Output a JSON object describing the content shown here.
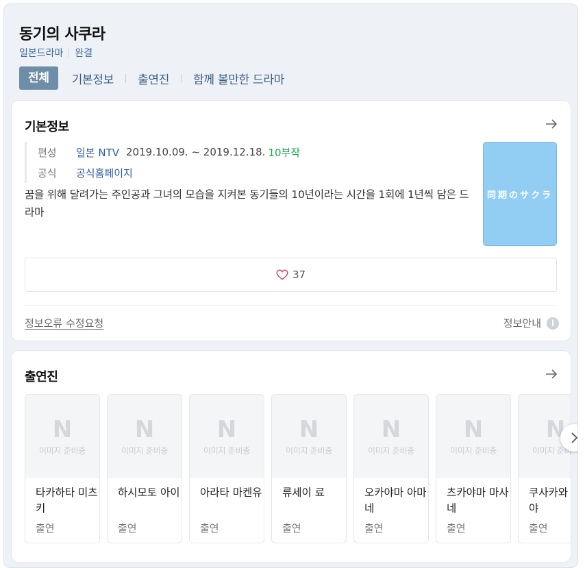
{
  "header": {
    "title": "동기의 사쿠라",
    "meta": [
      "일본드라마",
      "완결"
    ],
    "tabs": [
      {
        "label": "전체",
        "active": true
      },
      {
        "label": "기본정보",
        "active": false
      },
      {
        "label": "출연진",
        "active": false
      },
      {
        "label": "함께 볼만한 드라마",
        "active": false
      }
    ]
  },
  "basic_info": {
    "title": "기본정보",
    "broadcast_label": "편성",
    "broadcast_value": "일본 NTV",
    "broadcast_dates": "2019.10.09. ~ 2019.12.18.",
    "episodes": "10부작",
    "official_label": "공식",
    "official_value": "공식홈페이지",
    "description": "꿈을 위해 달려가는 주인공과 그녀의 모습을 지켜본 동기들의 10년이라는 시간을 1회에 1년씩 담은 드라마",
    "poster_text": "同期のサクラ",
    "likes": "37",
    "report_link": "정보오류 수정요청",
    "info_link": "정보안내",
    "info_icon": "i"
  },
  "cast": {
    "title": "출연진",
    "placeholder_logo": "N",
    "placeholder_text": "이미지 준비중",
    "members": [
      {
        "name": "타카하타 미츠키",
        "role": "출연"
      },
      {
        "name": "하시모토 아이",
        "role": "출연"
      },
      {
        "name": "아라타 마켄유",
        "role": "출연"
      },
      {
        "name": "류세이 료",
        "role": "출연"
      },
      {
        "name": "오카야마 아마네",
        "role": "출연"
      },
      {
        "name": "츠카야마 마사네",
        "role": "출연"
      },
      {
        "name": "쿠사카와 타쿠야",
        "role": "출연"
      }
    ]
  },
  "colors": {
    "accent_tab": "#6e8ea8",
    "link_blue": "#2d5fa0",
    "episodes_green": "#1aa84b",
    "poster_bg": "#92cdf4"
  },
  "icons": {
    "arrow": "arrow-right-icon",
    "heart": "heart-icon",
    "info": "info-icon",
    "next": "chevron-right-icon"
  }
}
